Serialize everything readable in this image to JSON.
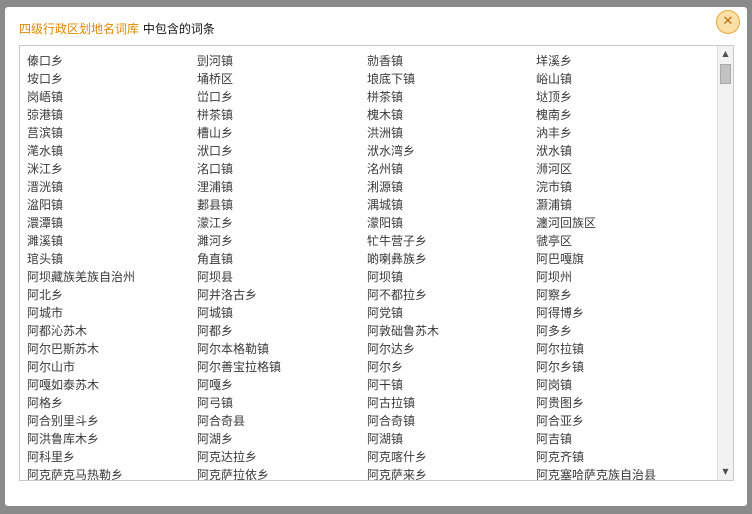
{
  "dialog": {
    "title_library": "四级行政区划地名词库",
    "title_suffix": " 中包含的词条",
    "close_icon": "close-icon",
    "close_glyph": "✕",
    "accent_color": "#e08a00"
  },
  "scrollbar": {
    "up_glyph": "▲",
    "down_glyph": "▼"
  },
  "entries": [
    "傣口乡",
    "剅河镇",
    "勍香镇",
    "垟溪乡",
    "垵口乡",
    "埇桥区",
    "埌底下镇",
    "峪山镇",
    "岗峿镇",
    "峃口乡",
    "栟茶镇",
    "垯顶乡",
    "弶港镇",
    "栟茶镇",
    "槐木镇",
    "槐南乡",
    "莒滨镇",
    "槽山乡",
    "洪洲镇",
    "汭丰乡",
    "滗水镇",
    "洑口乡",
    "洑水湾乡",
    "洑水镇",
    "洣江乡",
    "洺口镇",
    "洺州镇",
    "浉河区",
    "溍洸镇",
    "浬浦镇",
    "浰源镇",
    "浣市镇",
    "湓阳镇",
    "郪县镇",
    "湡城镇",
    "灏浦镇",
    "澴潭镇",
    "濛江乡",
    "濛阳镇",
    "瀍河回族区",
    "濉溪镇",
    "濉河乡",
    "牤牛营子乡",
    "虢亭区",
    "琯头镇",
    "角直镇",
    "啲喇彝族乡",
    "阿巴嘎旗",
    "阿坝藏族羌族自治州",
    "阿坝县",
    "阿坝镇",
    "阿坝州",
    "阿北乡",
    "阿并洛古乡",
    "阿不都拉乡",
    "阿察乡",
    "阿城市",
    "阿城镇",
    "阿党镇",
    "阿得博乡",
    "阿都沁苏木",
    "阿都乡",
    "阿敦础鲁苏木",
    "阿多乡",
    "阿尔巴斯苏木",
    "阿尔本格勒镇",
    "阿尔达乡",
    "阿尔拉镇",
    "阿尔山市",
    "阿尔善宝拉格镇",
    "阿尔乡",
    "阿尔乡镇",
    "阿嘎如泰苏木",
    "阿嘎乡",
    "阿干镇",
    "阿岗镇",
    "阿格乡",
    "阿弓镇",
    "阿古拉镇",
    "阿贵图乡",
    "阿合别里斗乡",
    "阿合奇县",
    "阿合奇镇",
    "阿合亚乡",
    "阿洪鲁库木乡",
    "阿湖乡",
    "阿湖镇",
    "阿吉镇",
    "阿科里乡",
    "阿克达拉乡",
    "阿克喀什乡",
    "阿克齐镇",
    "阿克萨克马热勒乡",
    "阿克萨拉依乡",
    "阿克萨来乡",
    "阿克塞哈萨克族自治县"
  ]
}
